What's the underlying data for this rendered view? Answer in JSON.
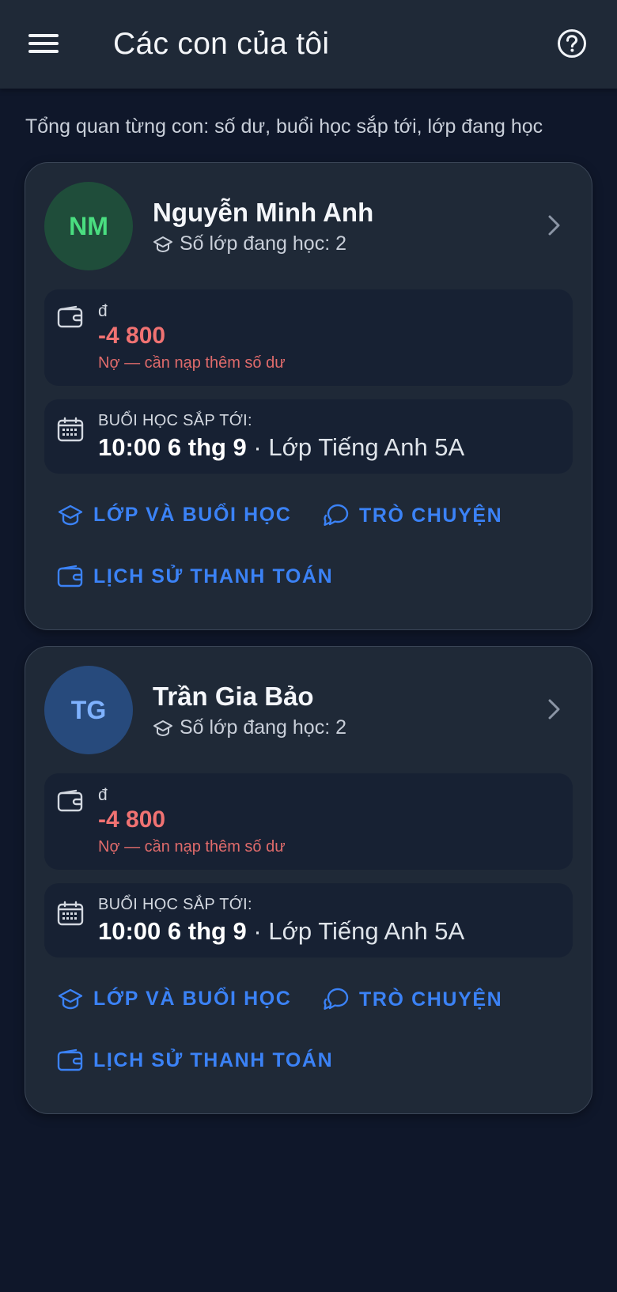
{
  "appbar": {
    "title": "Các con của tôi",
    "menu_icon": "hamburger-menu-icon",
    "help_icon": "help-circle-icon"
  },
  "subtitle": "Tổng quan từng con: số dư, buổi học sắp tới, lớp đang học",
  "colors": {
    "background": "#0f172a",
    "card": "#1f2937",
    "info_box": "#172133",
    "accent": "#3b82f6",
    "debt": "#f07272"
  },
  "children": [
    {
      "initials": "NM",
      "avatar_bg": "#1f4d3a",
      "avatar_fg": "#4ade80",
      "name": "Nguyễn Minh Anh",
      "class_count": "Số lớp đang học: 2",
      "balance": {
        "currency": "đ",
        "value": "-4 800",
        "note": "Nợ — cần nạp thêm số dư"
      },
      "upcoming": {
        "label": "BUỔI HỌC SẮP TỚI:",
        "time": "10:00 6 thg 9",
        "class": " · Lớp Tiếng Anh 5A"
      },
      "actions": {
        "classes": "LỚP VÀ BUỔI HỌC",
        "chat": "TRÒ CHUYỆN",
        "history": "LỊCH SỬ THANH TOÁN"
      }
    },
    {
      "initials": "TG",
      "avatar_bg": "#274a7c",
      "avatar_fg": "#7fb2ff",
      "name": "Trần Gia Bảo",
      "class_count": "Số lớp đang học: 2",
      "balance": {
        "currency": "đ",
        "value": "-4 800",
        "note": "Nợ — cần nạp thêm số dư"
      },
      "upcoming": {
        "label": "BUỔI HỌC SẮP TỚI:",
        "time": "10:00 6 thg 9",
        "class": " · Lớp Tiếng Anh 5A"
      },
      "actions": {
        "classes": "LỚP VÀ BUỔI HỌC",
        "chat": "TRÒ CHUYỆN",
        "history": "LỊCH SỬ THANH TOÁN"
      }
    }
  ]
}
